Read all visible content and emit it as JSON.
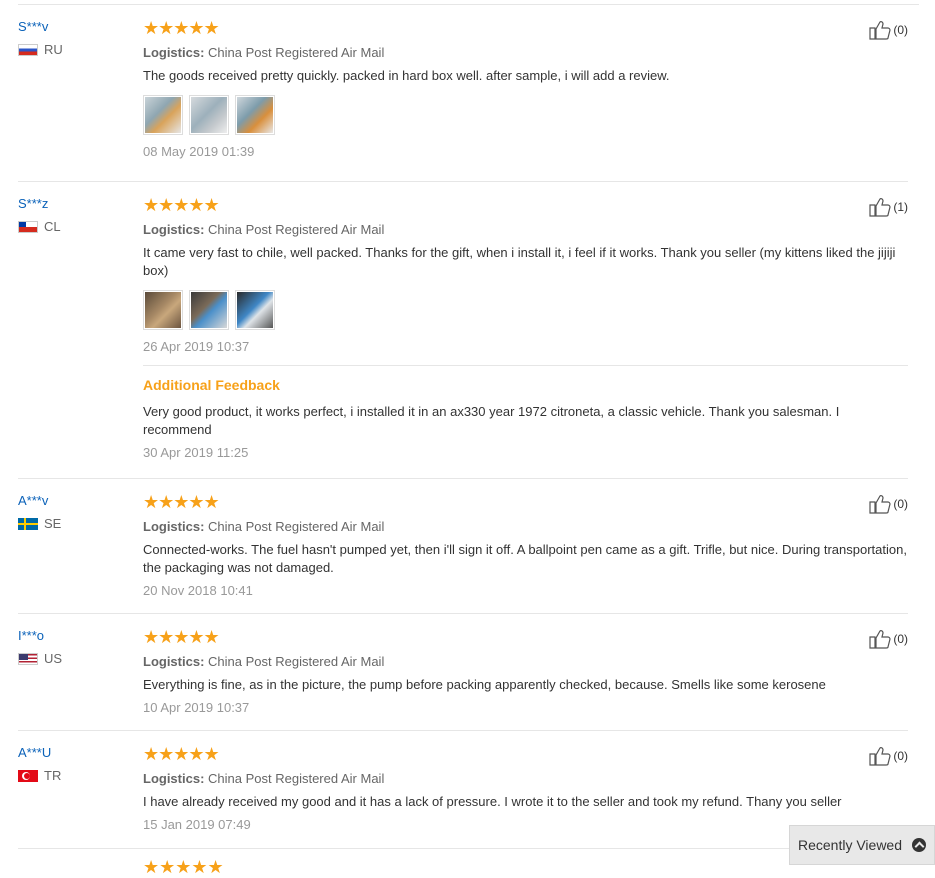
{
  "reviews": [
    {
      "user": "S***v",
      "country": "RU",
      "stars": "★★★★★",
      "logistics_label": "Logistics:",
      "logistics_value": "China Post Registered Air Mail",
      "text": "The goods received pretty quickly. packed in hard box well. after sample, i will add a review.",
      "date": "08 May 2019 01:39",
      "likes": "(0)"
    },
    {
      "user": "S***z",
      "country": "CL",
      "stars": "★★★★★",
      "logistics_label": "Logistics:",
      "logistics_value": "China Post Registered Air Mail",
      "text": "It came very fast to chile, well packed. Thanks for the gift, when i install it, i feel if it works. Thank you seller (my kittens liked the jijiji box)",
      "date": "26 Apr 2019 10:37",
      "likes": "(1)",
      "additional_title": "Additional Feedback",
      "additional_text": "Very good product, it works perfect, i installed it in an ax330 year 1972 citroneta, a classic vehicle. Thank you salesman. I recommend",
      "additional_date": "30 Apr 2019 11:25"
    },
    {
      "user": "A***v",
      "country": "SE",
      "stars": "★★★★★",
      "logistics_label": "Logistics:",
      "logistics_value": "China Post Registered Air Mail",
      "text": "Connected-works. The fuel hasn't pumped yet, then i'll sign it off. A ballpoint pen came as a gift. Trifle, but nice. During transportation, the packaging was not damaged.",
      "date": "20 Nov 2018 10:41",
      "likes": "(0)"
    },
    {
      "user": "I***o",
      "country": "US",
      "stars": "★★★★★",
      "logistics_label": "Logistics:",
      "logistics_value": "China Post Registered Air Mail",
      "text": "Everything is fine, as in the picture, the pump before packing apparently checked, because. Smells like some kerosene",
      "date": "10 Apr 2019 10:37",
      "likes": "(0)"
    },
    {
      "user": "A***U",
      "country": "TR",
      "stars": "★★★★★",
      "logistics_label": "Logistics:",
      "logistics_value": "China Post Registered Air Mail",
      "text": "I have already received my good and it has a lack of pressure. I wrote it to the seller and took my refund. Thany you seller",
      "date": "15 Jan 2019 07:49",
      "likes": "(0)"
    }
  ],
  "recently_viewed": "Recently Viewed",
  "colors": {
    "accent": "#f7a119",
    "link": "#0b62b9"
  },
  "icons": {
    "like": "thumbs-up-icon",
    "scroll_up": "chevron-up-icon"
  }
}
